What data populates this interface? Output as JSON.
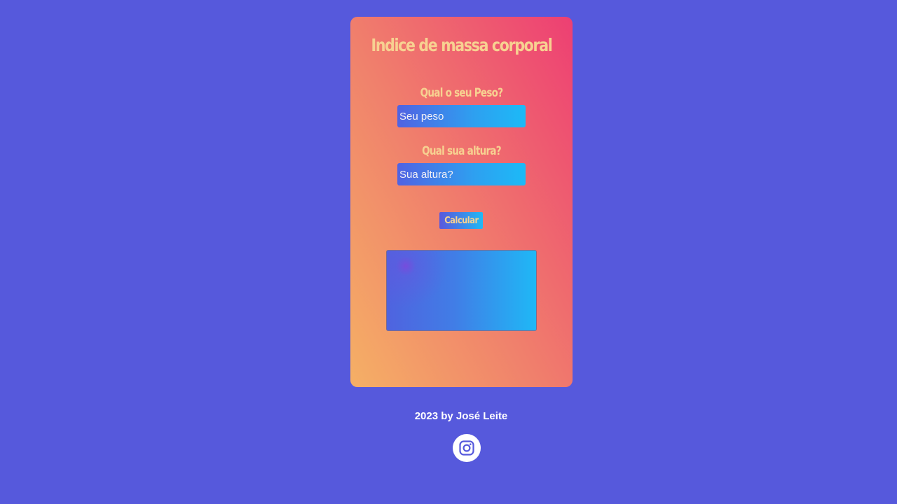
{
  "card": {
    "title": "Indice de massa corporal",
    "weight": {
      "label": "Qual o seu Peso?",
      "placeholder": "Seu peso"
    },
    "height": {
      "label": "Qual sua altura?",
      "placeholder": "Sua altura?"
    },
    "calculate_label": "Calcular",
    "result_text": ""
  },
  "footer": {
    "credit": "2023 by José Leite",
    "social_icon": "instagram-icon"
  },
  "colors": {
    "background": "#5659dc",
    "card_gradient": [
      "#f5b065",
      "#f0806c",
      "#ed3f73"
    ],
    "accent_text": "#f7d191",
    "field_gradient": [
      "#5162e2",
      "#1cbaf7"
    ]
  }
}
